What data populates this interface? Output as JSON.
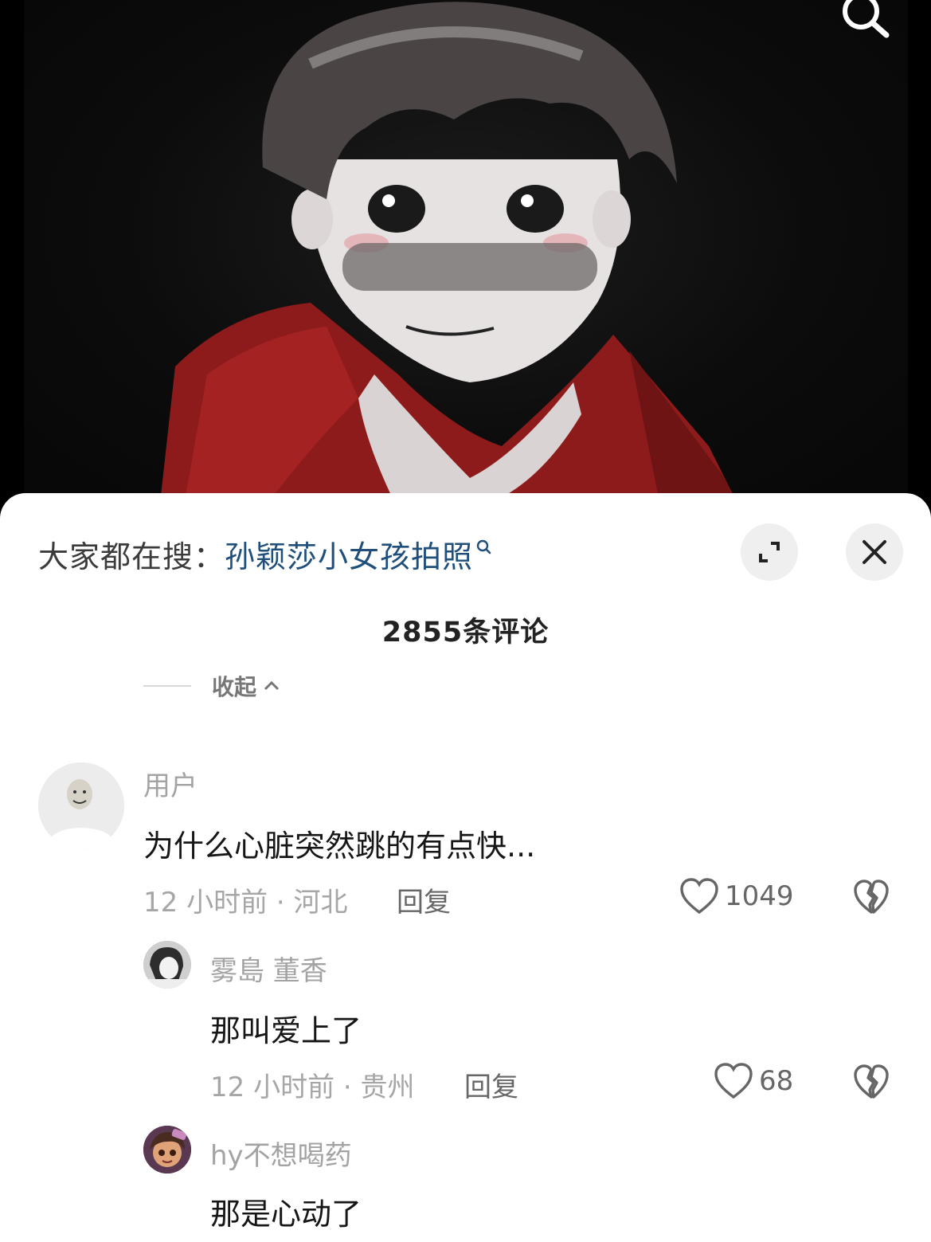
{
  "top_media": {
    "search_icon": "search-icon",
    "artwork": "illustrated-child-portrait"
  },
  "sheet": {
    "search_prefix": "大家都在搜：",
    "search_query": "孙颖莎小女孩拍照",
    "comment_count": "2855条评论",
    "collapse_label": "收起",
    "icons": {
      "expand": "expand-icon",
      "close": "close-icon"
    }
  },
  "comments": [
    {
      "user": "用户",
      "text": "为什么心脏突然跳的有点快...",
      "time_location": "12 小时前 · 河北",
      "reply_label": "回复",
      "likes": "1049"
    }
  ],
  "replies": [
    {
      "user": "雾島 董香",
      "text": "那叫爱上了",
      "time_location": "12 小时前 · 贵州",
      "reply_label": "回复",
      "likes": "68"
    },
    {
      "user": "hy不想喝药",
      "text": "那是心动了"
    }
  ],
  "colors": {
    "link": "#1f4f7a",
    "secondary_text": "#a6a6a6",
    "primary_text": "#161616"
  }
}
